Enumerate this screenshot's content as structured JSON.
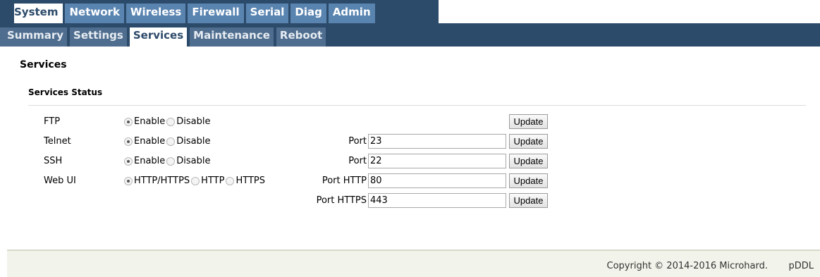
{
  "top_tabs": [
    "System",
    "Network",
    "Wireless",
    "Firewall",
    "Serial",
    "Diag",
    "Admin"
  ],
  "sub_tabs": [
    "Summary",
    "Settings",
    "Services",
    "Maintenance",
    "Reboot"
  ],
  "page": {
    "title": "Services",
    "section_title": "Services Status"
  },
  "services": {
    "ftp": {
      "label": "FTP",
      "opt1": "Enable",
      "opt2": "Disable",
      "selected": "Enable",
      "update": "Update"
    },
    "telnet": {
      "label": "Telnet",
      "opt1": "Enable",
      "opt2": "Disable",
      "selected": "Enable",
      "port_label": "Port",
      "port": "23",
      "update": "Update"
    },
    "ssh": {
      "label": "SSH",
      "opt1": "Enable",
      "opt2": "Disable",
      "selected": "Enable",
      "port_label": "Port",
      "port": "22",
      "update": "Update"
    },
    "webui": {
      "label": "Web UI",
      "opt1": "HTTP/HTTPS",
      "opt2": "HTTP",
      "opt3": "HTTPS",
      "selected": "HTTP/HTTPS",
      "port_http_label": "Port HTTP",
      "port_http": "80",
      "port_https_label": "Port HTTPS",
      "port_https": "443",
      "update_http": "Update",
      "update_https": "Update"
    }
  },
  "footer": {
    "copyright": "Copyright © 2014-2016 Microhard.",
    "product": "pDDL"
  }
}
